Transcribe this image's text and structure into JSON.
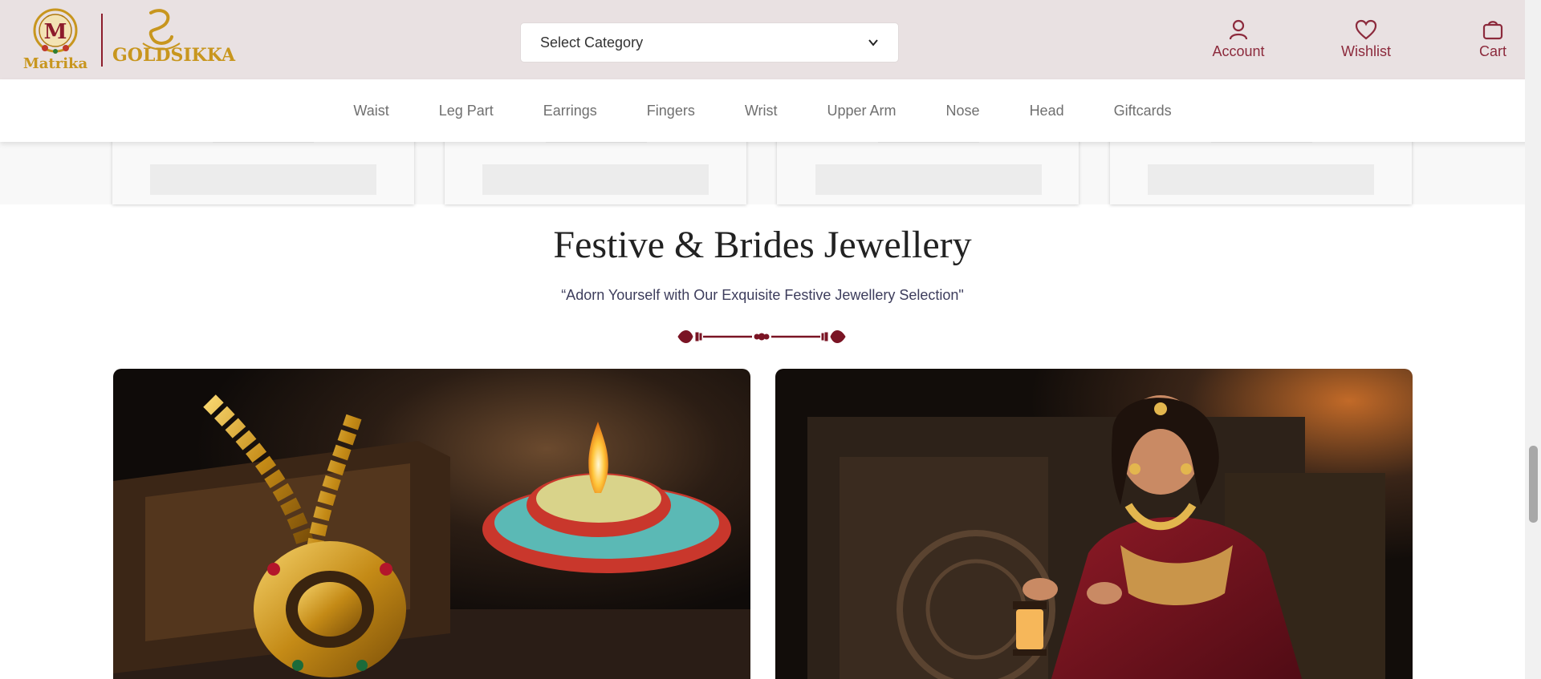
{
  "header": {
    "logo_primary": "Matrika",
    "logo_secondary": "GOLDSIKKA",
    "category_select": {
      "selected": "Select Category"
    },
    "actions": [
      {
        "label": "Account",
        "icon": "user-icon"
      },
      {
        "label": "Wishlist",
        "icon": "heart-icon"
      },
      {
        "label": "Cart",
        "icon": "bag-icon"
      }
    ]
  },
  "nav": {
    "items": [
      "Waist",
      "Leg Part",
      "Earrings",
      "Fingers",
      "Wrist",
      "Upper Arm",
      "Nose",
      "Head",
      "Giftcards"
    ]
  },
  "festive": {
    "title": "Festive & Brides Jewellery",
    "subtitle": "“Adorn Yourself with Our Exquisite Festive Jewellery Selection\""
  },
  "colors": {
    "header_bg": "#e9e1e2",
    "brand_maroon": "#8c2a3c",
    "gold": "#c8961e"
  }
}
